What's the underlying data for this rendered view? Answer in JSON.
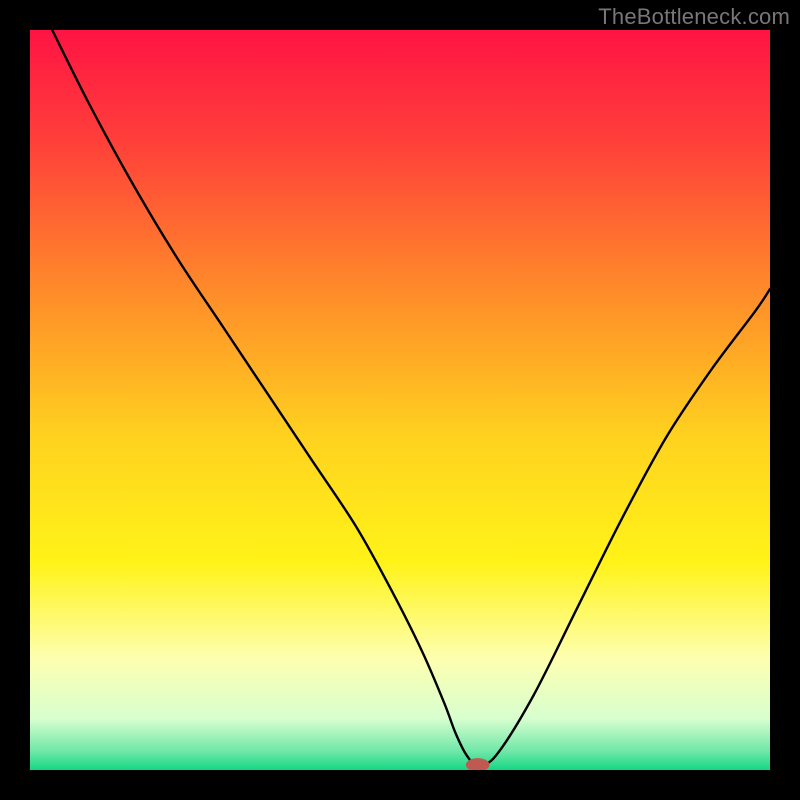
{
  "watermark": "TheBottleneck.com",
  "chart_data": {
    "type": "line",
    "title": "",
    "xlabel": "",
    "ylabel": "",
    "xlim": [
      0,
      100
    ],
    "ylim": [
      0,
      100
    ],
    "grid": false,
    "legend": false,
    "background": {
      "type": "vertical-gradient",
      "stops": [
        {
          "pos": 0.0,
          "color": "#ff1444"
        },
        {
          "pos": 0.15,
          "color": "#ff3f3a"
        },
        {
          "pos": 0.35,
          "color": "#ff8a2a"
        },
        {
          "pos": 0.55,
          "color": "#ffd21f"
        },
        {
          "pos": 0.72,
          "color": "#fff318"
        },
        {
          "pos": 0.85,
          "color": "#fdffb0"
        },
        {
          "pos": 0.93,
          "color": "#d8ffcf"
        },
        {
          "pos": 0.975,
          "color": "#6fe7a8"
        },
        {
          "pos": 1.0,
          "color": "#14d884"
        }
      ]
    },
    "series": [
      {
        "name": "bottleneck-curve",
        "color": "#000000",
        "x": [
          3,
          8,
          14,
          20,
          26,
          32,
          38,
          44,
          49,
          53,
          56,
          57.5,
          59,
          60.5,
          63,
          68,
          74,
          80,
          86,
          92,
          98,
          100
        ],
        "y": [
          100,
          90,
          79,
          69,
          60,
          51,
          42,
          33,
          24,
          16,
          9,
          5,
          2,
          0.7,
          2,
          10,
          22,
          34,
          45,
          54,
          62,
          65
        ]
      }
    ],
    "marker": {
      "name": "optimal-point",
      "x": 60.5,
      "y": 0.7,
      "color": "#c05a50",
      "rx": 1.6,
      "ry": 0.9
    }
  }
}
